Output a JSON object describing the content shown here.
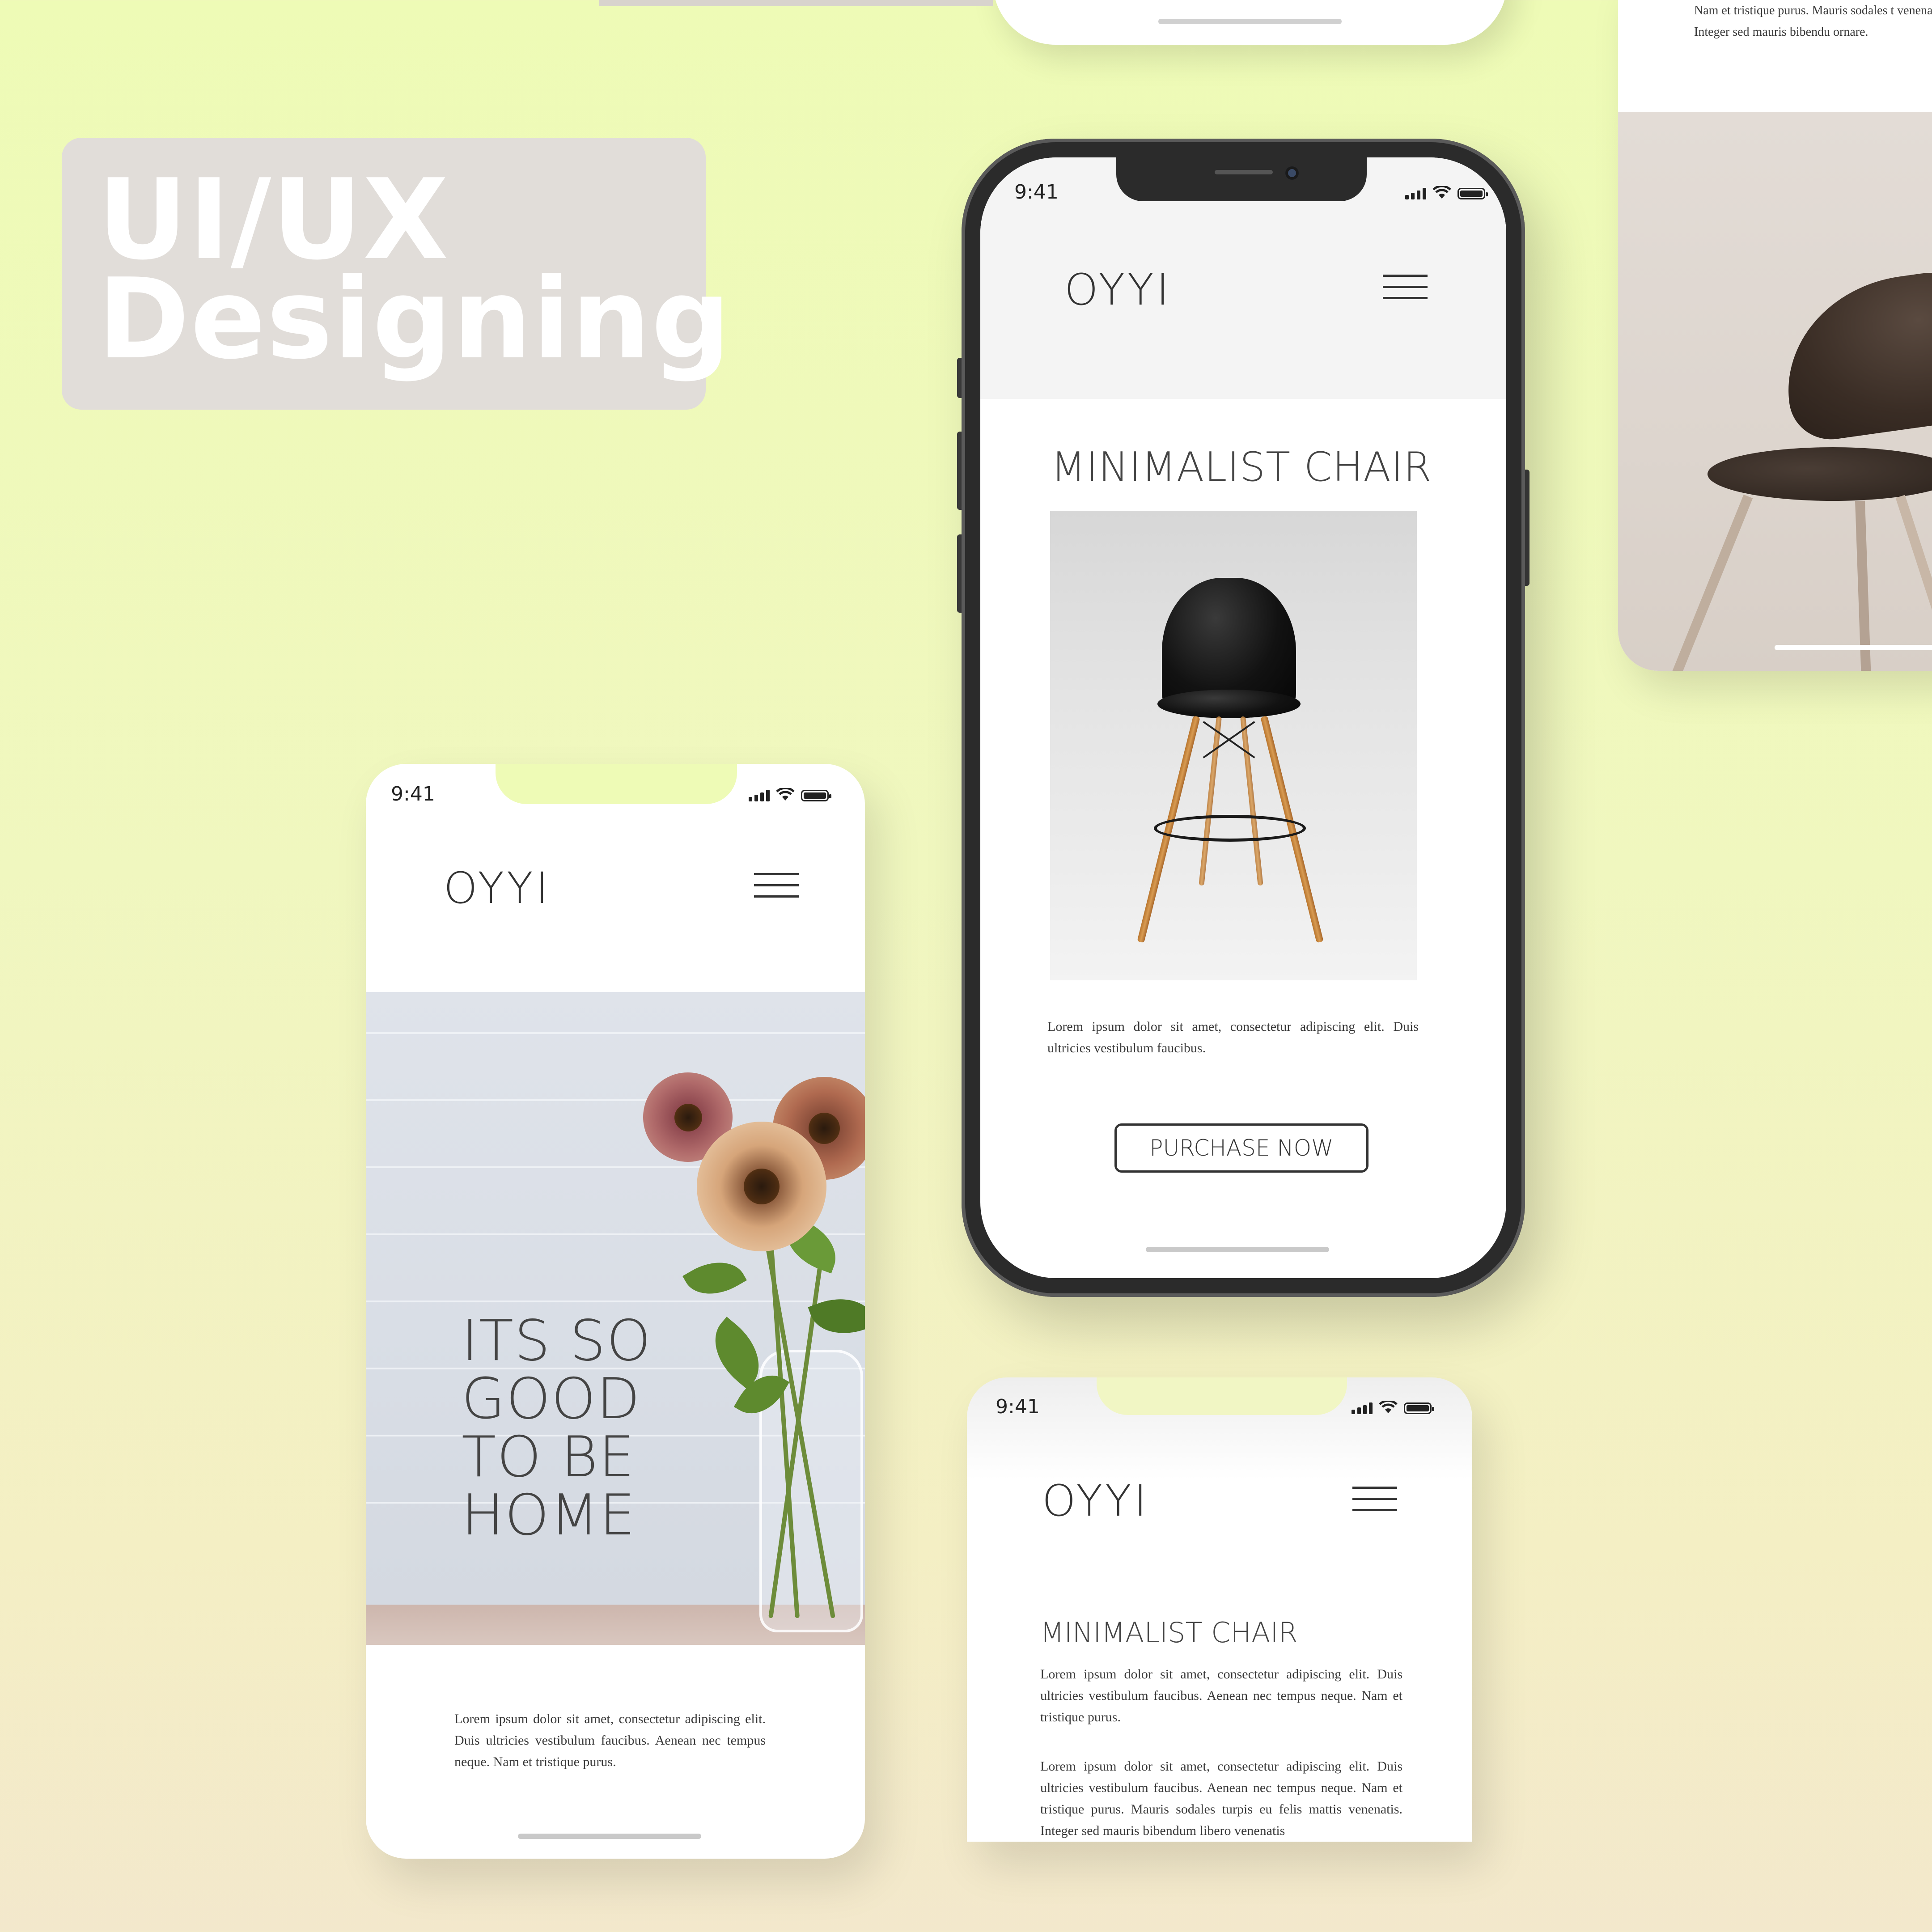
{
  "badge": {
    "line1": "UI/UX",
    "line2": "Designing"
  },
  "center_phone": {
    "time": "9:41",
    "logo": "OYYI",
    "title": "MINIMALIST CHAIR",
    "description": "Lorem ipsum dolor sit amet, consectetur adipiscing elit. Duis ultricies vestibulum faucibus.",
    "cta": "PURCHASE NOW"
  },
  "left_phone": {
    "time": "9:41",
    "logo": "OYYI",
    "hero_lines": [
      "ITS SO",
      "GOOD",
      "TO BE",
      "HOME"
    ],
    "description": "Lorem ipsum dolor sit amet, consectetur adipiscing elit. Duis ultricies vestibulum faucibus. Aenean nec tempus neque. Nam et tristique purus."
  },
  "bottom_phone": {
    "time": "9:41",
    "logo": "OYYI",
    "title": "MINIMALIST CHAIR",
    "paragraph1": "Lorem ipsum dolor sit amet, consectetur adipiscing elit. Duis ultricies vestibulum faucibus. Aenean nec tempus neque. Nam et tristique purus.",
    "paragraph2": "Lorem ipsum dolor sit amet, consectetur adipiscing elit. Duis ultricies vestibulum faucibus. Aenean nec tempus neque. Nam et tristique purus. Mauris sodales turpis eu felis mattis venenatis. Integer sed mauris bibendum libero venenatis"
  },
  "right_phone": {
    "text": "Nam et tristique purus. Mauris sodales t venenatis. Integer sed mauris bibendu ornare."
  },
  "colors": {
    "background_top": "#eefbb6",
    "background_bottom": "#f3e8cc",
    "badge_bg": "#e1ddd9",
    "phone_frame": "#2b2b2b",
    "text_dark": "#333333"
  },
  "icons": [
    "cellular-signal-icon",
    "wifi-icon",
    "battery-icon",
    "hamburger-menu-icon"
  ]
}
